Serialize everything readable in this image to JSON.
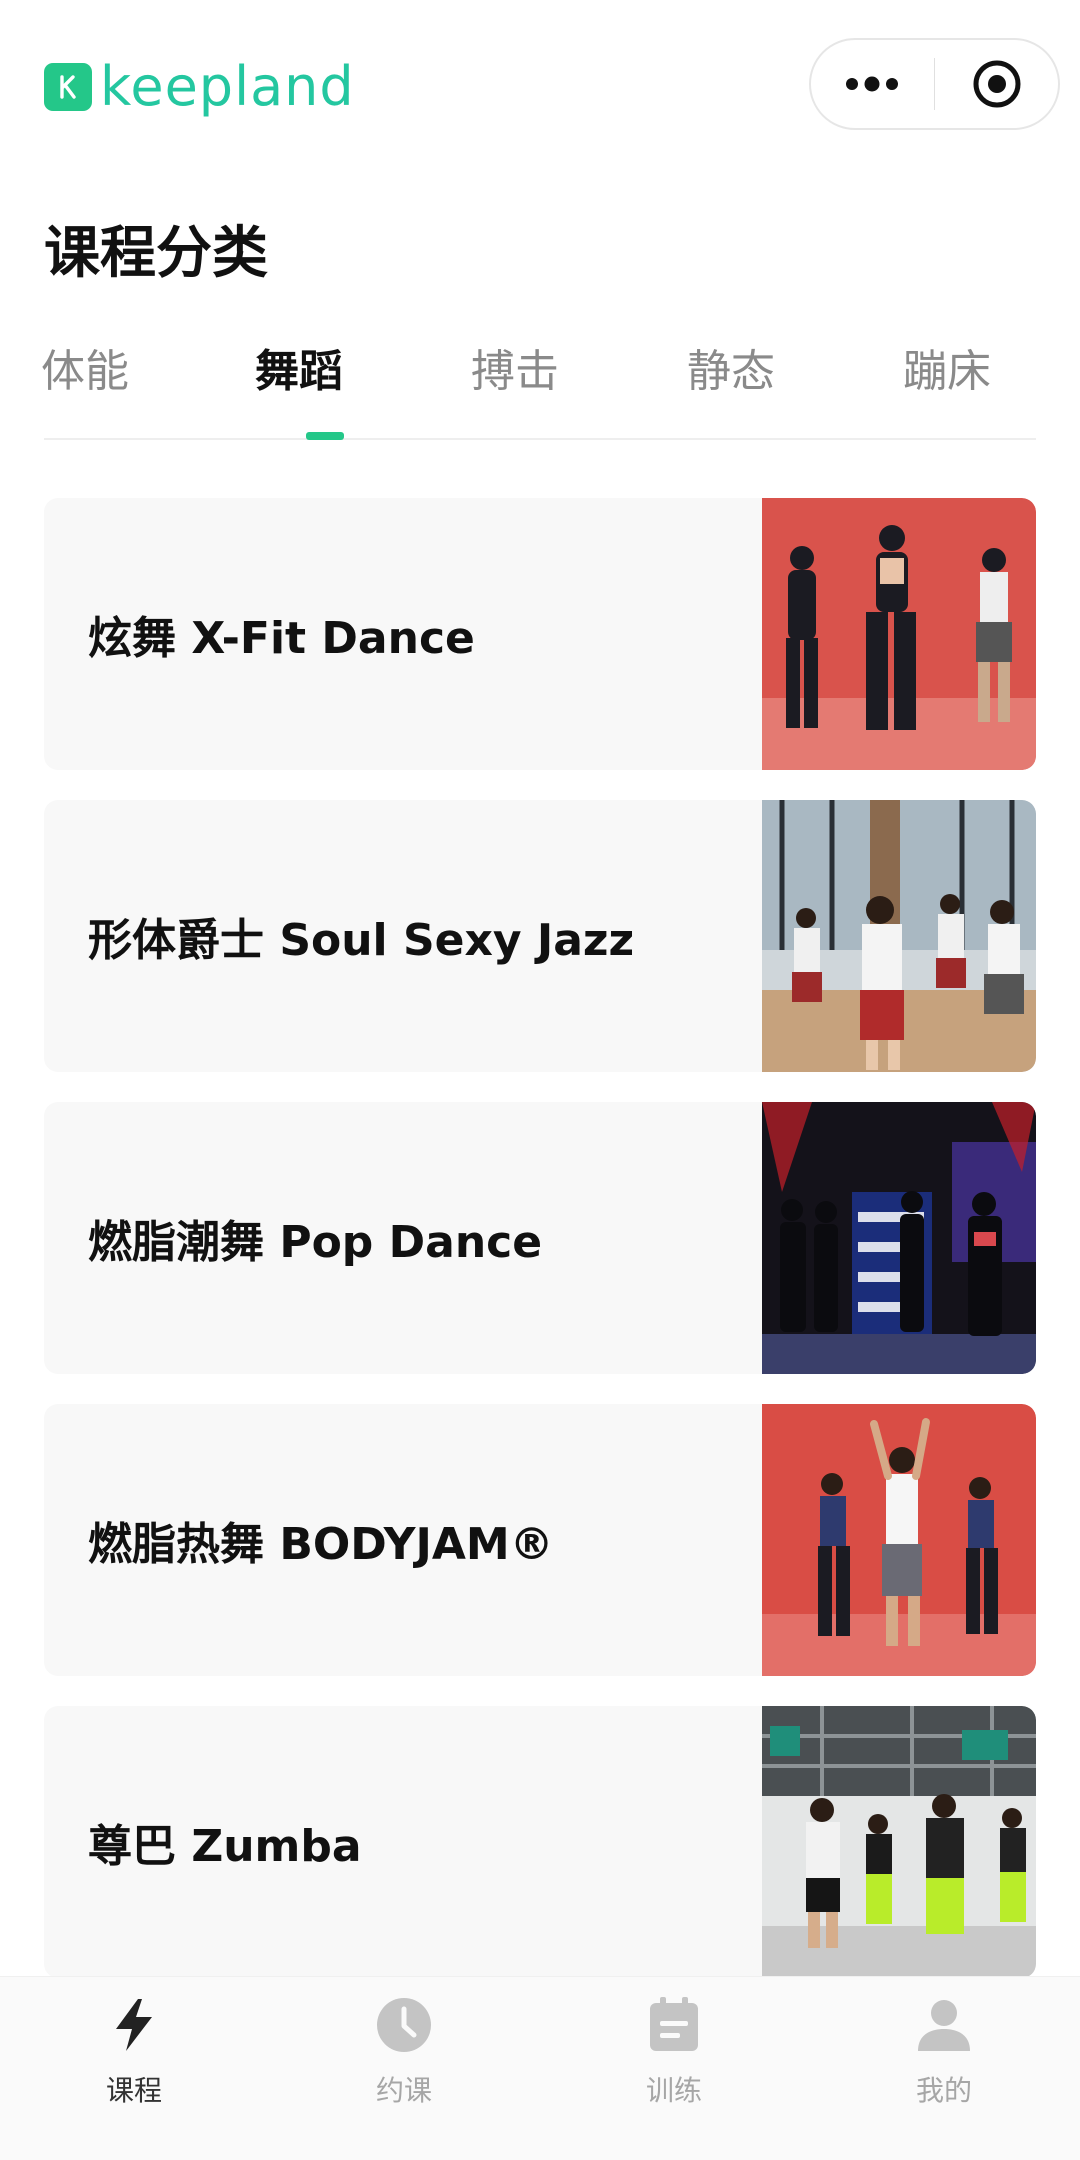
{
  "header": {
    "logo_text": "keepland",
    "more_icon": "more-dots-icon",
    "close_icon": "target-circle-icon"
  },
  "page_title": "课程分类",
  "tabs": [
    {
      "label": "体能",
      "active": false
    },
    {
      "label": "舞蹈",
      "active": true
    },
    {
      "label": "搏击",
      "active": false
    },
    {
      "label": "静态",
      "active": false
    },
    {
      "label": "蹦床",
      "active": false
    }
  ],
  "courses": [
    {
      "title": "炫舞 X-Fit Dance",
      "image": "dancers-red-backdrop"
    },
    {
      "title": "形体爵士 Soul Sexy Jazz",
      "image": "jazz-class-studio"
    },
    {
      "title": "燃脂潮舞 Pop Dance",
      "image": "pop-dance-stage"
    },
    {
      "title": "燃脂热舞 BODYJAM®",
      "image": "bodyjam-red-backdrop"
    },
    {
      "title": "尊巴 Zumba",
      "image": "zumba-studio"
    }
  ],
  "bottom_nav": [
    {
      "label": "课程",
      "icon": "lightning-icon",
      "active": true
    },
    {
      "label": "约课",
      "icon": "clock-icon",
      "active": false
    },
    {
      "label": "训练",
      "icon": "calendar-note-icon",
      "active": false
    },
    {
      "label": "我的",
      "icon": "user-icon",
      "active": false
    }
  ],
  "colors": {
    "accent": "#24c789",
    "text_primary": "#111111",
    "text_muted": "#8a8a8a",
    "card_bg": "#f8f8f8"
  }
}
